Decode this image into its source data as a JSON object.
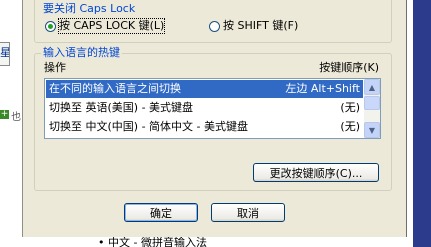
{
  "background": {
    "left_tab_1": "星",
    "plus_text": "也",
    "bottom_bullet": "•  中文 - 微拼音输入法"
  },
  "caps_group": {
    "title": "要关闭 Caps Lock",
    "option_capslock": "按 CAPS LOCK 键(L)",
    "option_shift": "按 SHIFT 键(F)",
    "selected": "capslock"
  },
  "hotkey_group": {
    "title": "输入语言的热键",
    "col_action": "操作",
    "col_key": "按键顺序(K)",
    "rows": [
      {
        "action": "在不同的输入语言之间切换",
        "key": "左边 Alt+Shift"
      },
      {
        "action": "切换至 英语(美国) - 美式键盘",
        "key": "(无)"
      },
      {
        "action": "切换至 中文(中国) - 简体中文 - 美式键盘",
        "key": "(无)"
      }
    ],
    "change_button": "更改按键顺序(C)..."
  },
  "buttons": {
    "ok": "确定",
    "cancel": "取消"
  },
  "colors": {
    "dialog_bg": "#ece9d8",
    "group_title": "#0046d5",
    "selection": "#316ac5"
  }
}
